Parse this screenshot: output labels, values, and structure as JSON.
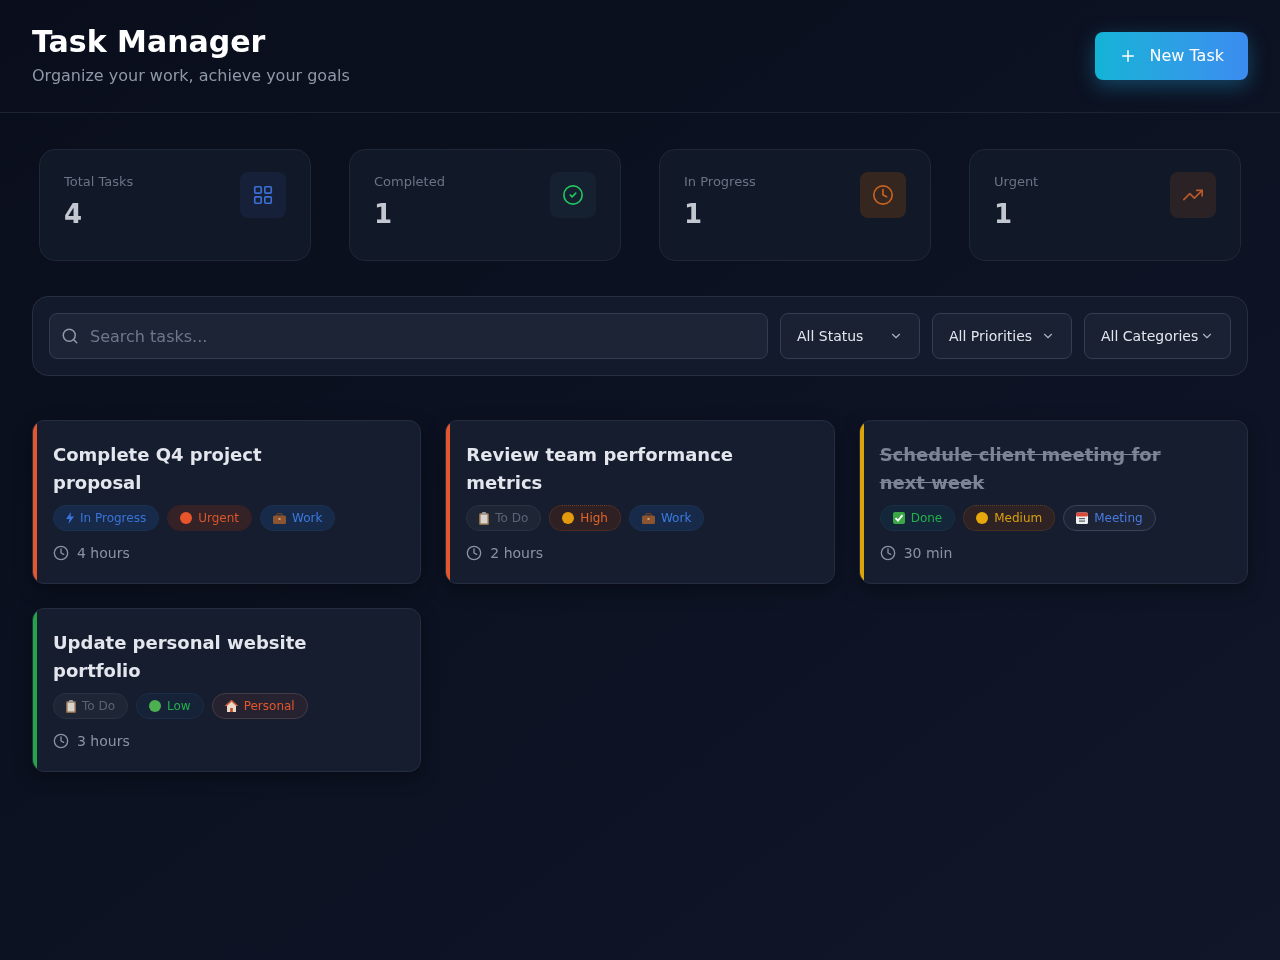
{
  "header": {
    "title": "Task Manager",
    "subtitle": "Organize your work, achieve your goals",
    "new_task_button": "New Task"
  },
  "stats": [
    {
      "kind": "total",
      "label": "Total Tasks",
      "value": "4"
    },
    {
      "kind": "completed",
      "label": "Completed",
      "value": "1"
    },
    {
      "kind": "in_progress",
      "label": "In Progress",
      "value": "1"
    },
    {
      "kind": "urgent",
      "label": "Urgent",
      "value": "1"
    }
  ],
  "filters": {
    "search": {
      "placeholder": "Search tasks..."
    },
    "selects": [
      {
        "value": "All Status"
      },
      {
        "value": "All Priorities"
      },
      {
        "value": "All Categories"
      }
    ]
  },
  "tasks": [
    {
      "title": "Complete Q4 project proposal",
      "completed": false,
      "color": "#e4572e",
      "status": {
        "kind": "in_progress",
        "label": "In Progress"
      },
      "priority": {
        "kind": "urgent",
        "label": "Urgent",
        "color": "#e8552a"
      },
      "category": {
        "kind": "work",
        "label": "Work"
      },
      "duration": "4 hours"
    },
    {
      "title": "Review team performance metrics",
      "completed": false,
      "color": "#e4572e",
      "status": {
        "kind": "todo",
        "label": "To Do"
      },
      "priority": {
        "kind": "high",
        "label": "High",
        "color": "#e39b0e"
      },
      "category": {
        "kind": "work",
        "label": "Work"
      },
      "duration": "2 hours"
    },
    {
      "title": "Schedule client meeting for next week",
      "completed": true,
      "color": "#dca30a",
      "status": {
        "kind": "done",
        "label": "Done"
      },
      "priority": {
        "kind": "medium",
        "label": "Medium",
        "color": "#e6a80c"
      },
      "category": {
        "kind": "meeting",
        "label": "Meeting"
      },
      "duration": "30 min"
    },
    {
      "title": "Update personal website portfolio",
      "completed": false,
      "color": "#22a447",
      "status": {
        "kind": "todo",
        "label": "To Do"
      },
      "priority": {
        "kind": "low",
        "label": "Low",
        "color": "#4caf50"
      },
      "category": {
        "kind": "personal",
        "label": "Personal"
      },
      "duration": "3 hours"
    }
  ]
}
